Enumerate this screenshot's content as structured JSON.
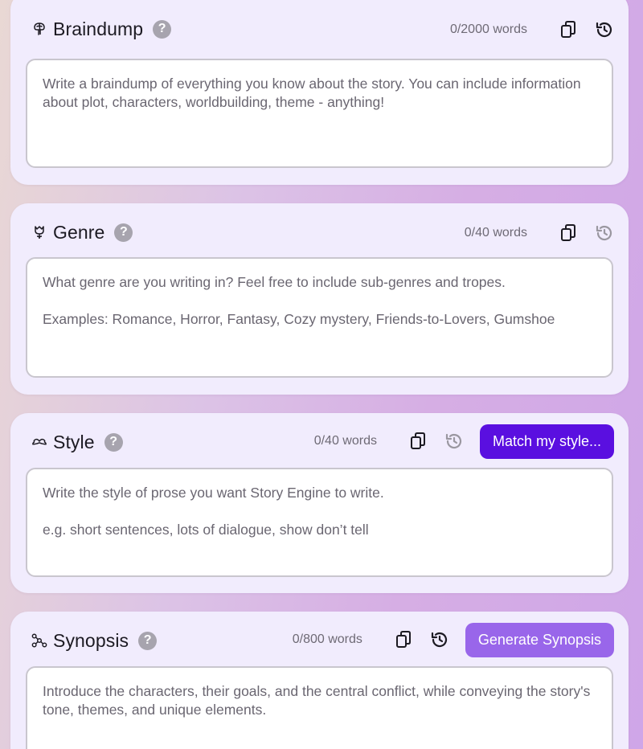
{
  "colors": {
    "card_bg": "#f1ecfd",
    "primary_button": "#5a0fe0",
    "secondary_button": "#9966ea",
    "help_icon": "#a7a4ae"
  },
  "sections": {
    "braindump": {
      "icon": "brain-icon",
      "title": "Braindump",
      "word_count": "0/2000 words",
      "placeholder": "Write a braindump of everything you know about the story. You can include information about plot, characters, worldbuilding, theme - anything!"
    },
    "genre": {
      "icon": "tulip-icon",
      "title": "Genre",
      "word_count": "0/40 words",
      "placeholder": "What genre are you writing in? Feel free to include sub-genres and tropes.\n\nExamples: Romance, Horror, Fantasy, Cozy mystery, Friends-to-Lovers, Gumshoe"
    },
    "style": {
      "icon": "mustache-icon",
      "title": "Style",
      "word_count": "0/40 words",
      "button": "Match my style...",
      "placeholder": "Write the style of prose you want Story Engine to write.\n\ne.g. short sentences, lots of dialogue, show don’t tell"
    },
    "synopsis": {
      "icon": "network-icon",
      "title": "Synopsis",
      "word_count": "0/800 words",
      "button": "Generate Synopsis",
      "placeholder": "Introduce the characters, their goals, and the central conflict, while conveying the story's tone, themes, and unique elements."
    }
  }
}
